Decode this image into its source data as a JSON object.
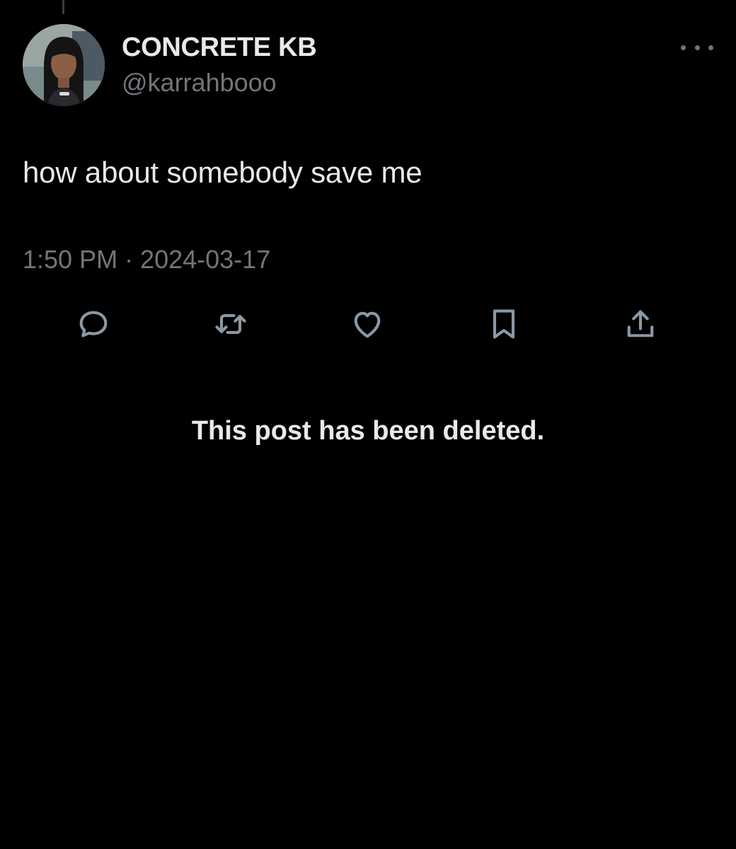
{
  "post": {
    "display_name": "CONCRETE KB",
    "handle": "@karrahbooo",
    "text": "how about somebody save me",
    "timestamp": "1:50 PM · 2024-03-17"
  },
  "actions": {
    "icons": [
      "reply-icon",
      "repost-icon",
      "like-icon",
      "bookmark-icon",
      "share-icon"
    ]
  },
  "notice": {
    "deleted_text": "This post has been deleted."
  },
  "colors": {
    "background": "#000000",
    "primary_text": "#e7e9ea",
    "secondary_text": "#71767b"
  }
}
